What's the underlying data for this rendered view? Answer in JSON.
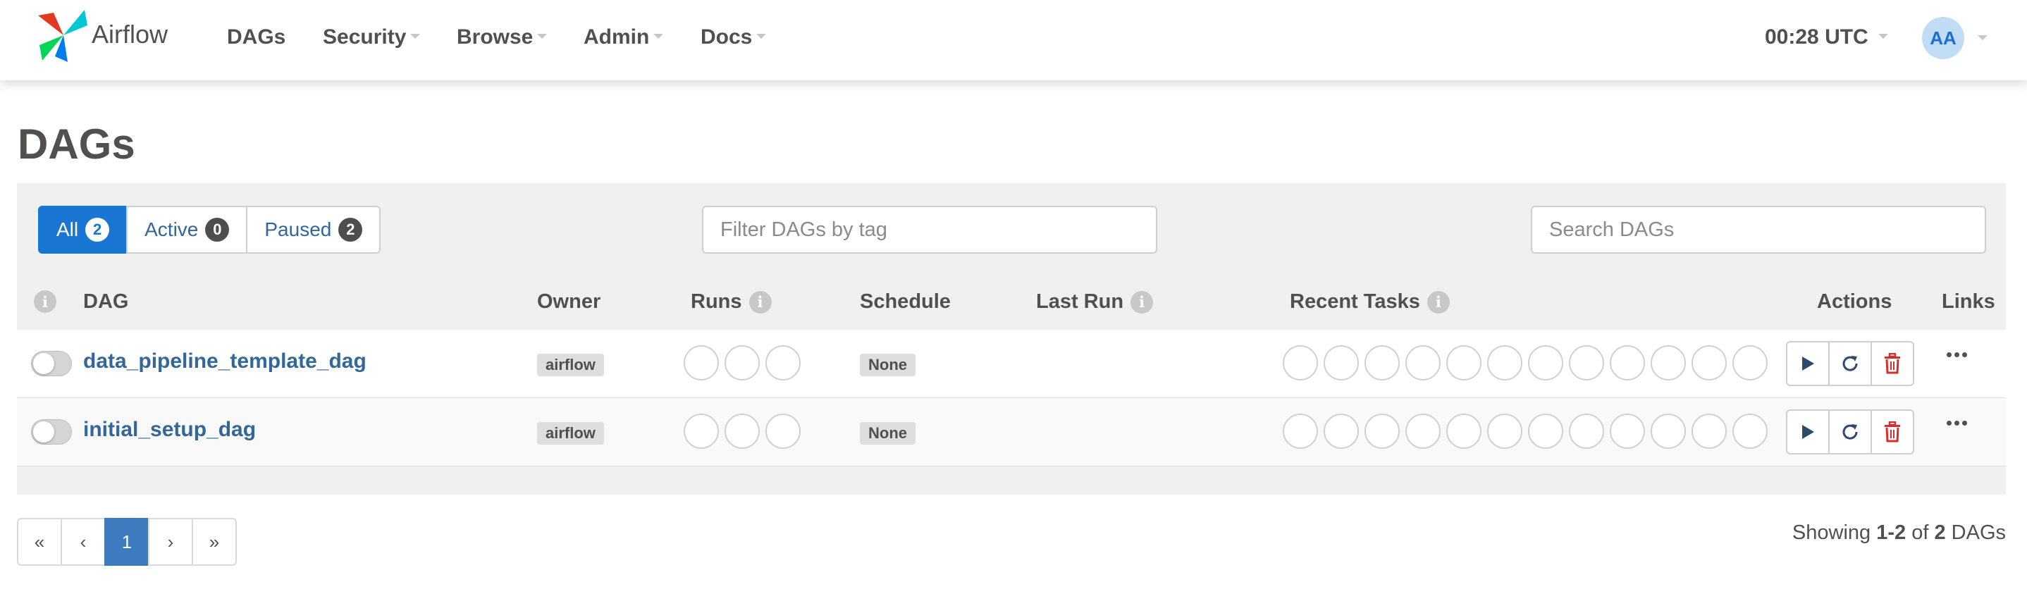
{
  "brand": {
    "name": "Airflow"
  },
  "nav": {
    "items": [
      {
        "label": "DAGs",
        "dropdown": false
      },
      {
        "label": "Security",
        "dropdown": true
      },
      {
        "label": "Browse",
        "dropdown": true
      },
      {
        "label": "Admin",
        "dropdown": true
      },
      {
        "label": "Docs",
        "dropdown": true
      }
    ],
    "clock": "00:28 UTC",
    "user_initials": "AA"
  },
  "page": {
    "title": "DAGs"
  },
  "filters": {
    "all_label": "All",
    "all_count": "2",
    "active_label": "Active",
    "active_count": "0",
    "paused_label": "Paused",
    "paused_count": "2",
    "tag_placeholder": "Filter DAGs by tag",
    "search_placeholder": "Search DAGs"
  },
  "table": {
    "headers": {
      "dag": "DAG",
      "owner": "Owner",
      "runs": "Runs",
      "schedule": "Schedule",
      "last_run": "Last Run",
      "recent_tasks": "Recent Tasks",
      "actions": "Actions",
      "links": "Links"
    },
    "rows": [
      {
        "dag_id": "data_pipeline_template_dag",
        "owner": "airflow",
        "schedule": "None",
        "paused": true
      },
      {
        "dag_id": "initial_setup_dag",
        "owner": "airflow",
        "schedule": "None",
        "paused": true
      }
    ]
  },
  "pagination": {
    "first": "«",
    "prev": "‹",
    "current": "1",
    "next": "›",
    "last": "»"
  },
  "summary": {
    "prefix": "Showing",
    "range": "1-2",
    "of": "of",
    "total": "2",
    "suffix": "DAGs"
  },
  "colors": {
    "accent": "#1976d2",
    "link": "#336699",
    "pager_active": "#3d7bbf",
    "delete": "#d32f2f",
    "panel_bg": "#f0f0f0"
  },
  "icons": [
    "pinwheel-logo",
    "info-icon",
    "play-icon",
    "refresh-icon",
    "trash-icon",
    "ellipsis-icon",
    "caret-down-icon"
  ]
}
